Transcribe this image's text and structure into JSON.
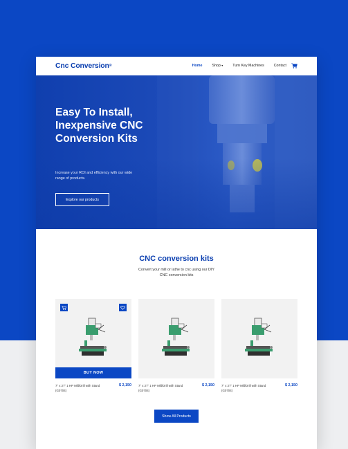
{
  "nav": {
    "logo": "Cnc Conversion",
    "logo_mark": "®",
    "links": [
      "Home",
      "Shop",
      "Turn Key Machines",
      "Contact"
    ],
    "shop_caret": "▾",
    "cart_icon": "cart-icon"
  },
  "hero": {
    "title": "Easy To Install, Inexpensive CNC Conversion Kits",
    "subtitle": "Increase your ROI and efficiency with our wide range of products.",
    "button": "Explore our products"
  },
  "section": {
    "title": "CNC conversion kits",
    "subtitle": "Convert your mill or lathe to cnc using our DIY CNC conversion kits"
  },
  "products": [
    {
      "name": "7\" x 27\" 1 HP Mill/Drill with Stand (G0704)",
      "price": "$ 2,150",
      "buy_label": "BUY NOW"
    },
    {
      "name": "7\" x 27\" 1 HP Mill/Drill with Stand (G0704)",
      "price": "$ 2,150"
    },
    {
      "name": "7\" x 27\" 1 HP Mill/Drill with Stand (G0704)",
      "price": "$ 2,150"
    }
  ],
  "show_all": "Show All Products",
  "colors": {
    "brand_blue": "#0b47c4",
    "logo_blue": "#0b3fb0",
    "machine_green": "#3a9d6e",
    "background_light": "#eeeff1"
  }
}
